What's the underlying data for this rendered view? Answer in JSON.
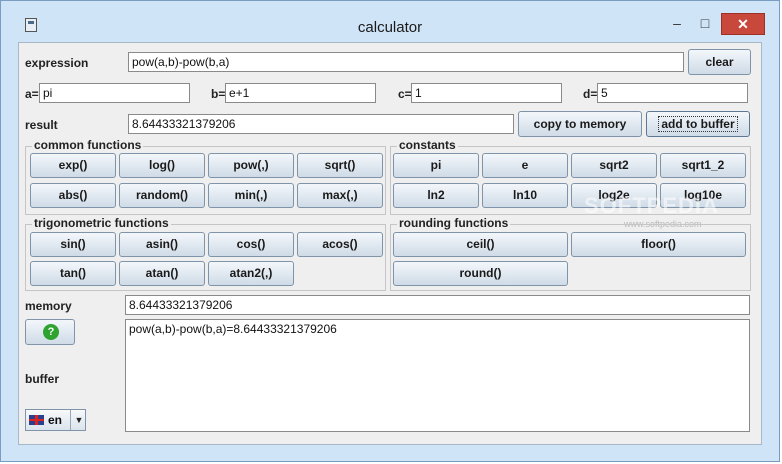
{
  "window": {
    "title": "calculator",
    "minimize": "–",
    "maximize": "□",
    "close": "✕"
  },
  "expression": {
    "label": "expression",
    "value": "pow(a,b)-pow(b,a)",
    "clear_label": "clear"
  },
  "variables": [
    {
      "label": "a=",
      "value": "pi"
    },
    {
      "label": "b=",
      "value": "e+1"
    },
    {
      "label": "c=",
      "value": "1"
    },
    {
      "label": "d=",
      "value": "5"
    }
  ],
  "result": {
    "label": "result",
    "value": "8.64433321379206",
    "copy_label": "copy to memory",
    "add_label": "add to buffer"
  },
  "common_functions": {
    "title": "common functions",
    "buttons": [
      "exp()",
      "log()",
      "pow(,)",
      "sqrt()",
      "abs()",
      "random()",
      "min(,)",
      "max(,)"
    ]
  },
  "constants": {
    "title": "constants",
    "buttons": [
      "pi",
      "e",
      "sqrt2",
      "sqrt1_2",
      "ln2",
      "ln10",
      "log2e",
      "log10e"
    ]
  },
  "trigonometric_functions": {
    "title": "trigonometric functions",
    "buttons": [
      "sin()",
      "asin()",
      "cos()",
      "acos()",
      "tan()",
      "atan()",
      "atan2(,)"
    ]
  },
  "rounding_functions": {
    "title": "rounding functions",
    "buttons": [
      "ceil()",
      "floor()",
      "round()"
    ]
  },
  "memory": {
    "label": "memory",
    "value": "8.64433321379206"
  },
  "help": {
    "icon": "?"
  },
  "buffer": {
    "label": "buffer",
    "content": "pow(a,b)-pow(b,a)=8.64433321379206"
  },
  "language": {
    "value": "en",
    "arrow": "▼"
  },
  "watermark": {
    "text": "SOFTPEDIA",
    "sub": "www.softpedia.com"
  },
  "colors": {
    "titlebar": "#cfe4f7",
    "panel": "#efefef",
    "close": "#c9483c",
    "help": "#2fa32f"
  }
}
